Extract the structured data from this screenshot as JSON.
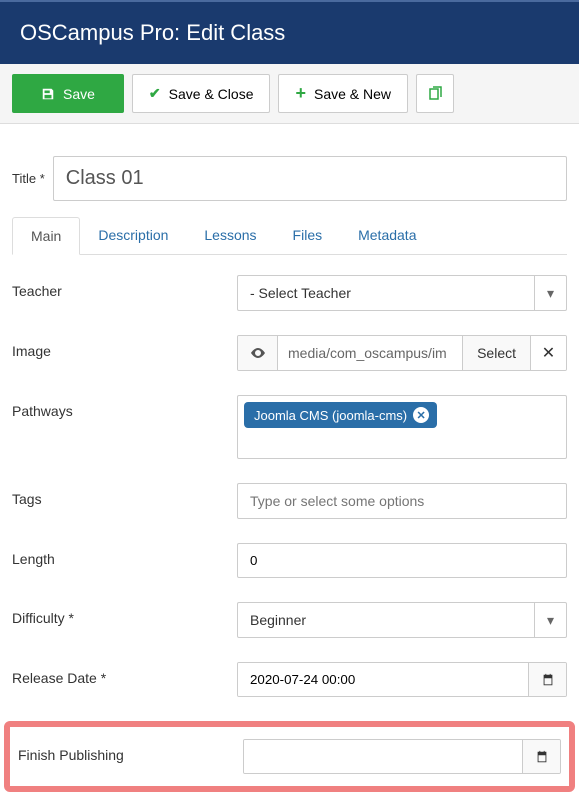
{
  "header": {
    "title": "OSCampus Pro: Edit Class"
  },
  "toolbar": {
    "save": "Save",
    "save_close": "Save & Close",
    "save_new": "Save & New"
  },
  "title_field": {
    "label": "Title *",
    "value": "Class 01"
  },
  "tabs": {
    "main": "Main",
    "description": "Description",
    "lessons": "Lessons",
    "files": "Files",
    "metadata": "Metadata"
  },
  "form": {
    "teacher": {
      "label": "Teacher",
      "value": "- Select Teacher"
    },
    "image": {
      "label": "Image",
      "path": "media/com_oscampus/im",
      "select_btn": "Select"
    },
    "pathways": {
      "label": "Pathways",
      "chip": "Joomla CMS (joomla-cms)"
    },
    "tags": {
      "label": "Tags",
      "placeholder": "Type or select some options"
    },
    "length": {
      "label": "Length",
      "value": "0"
    },
    "difficulty": {
      "label": "Difficulty *",
      "value": "Beginner"
    },
    "release_date": {
      "label": "Release Date *",
      "value": "2020-07-24 00:00"
    },
    "finish_publishing": {
      "label": "Finish Publishing",
      "value": ""
    }
  }
}
